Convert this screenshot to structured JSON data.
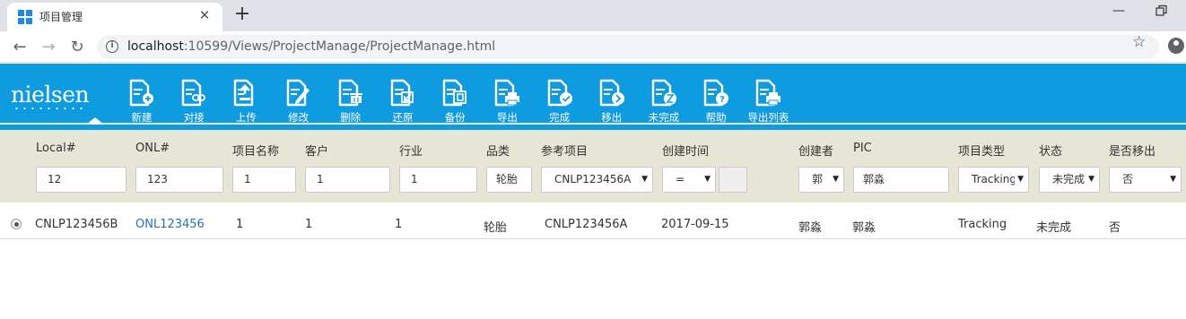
{
  "browser": {
    "tab_title": "项目管理",
    "tab_close": "✕",
    "new_tab": "+",
    "minimize": "—",
    "url_host": "localhost",
    "url_rest": ":10599/Views/ProjectManage/ProjectManage.html",
    "back": "←",
    "forward": "→",
    "reload": "↻",
    "star": "☆"
  },
  "app": {
    "logo": "nielsen",
    "accent_color": "#0f9be0",
    "toolbar": [
      {
        "label": "新建",
        "icon": "new-doc-icon"
      },
      {
        "label": "对接",
        "icon": "link-doc-icon"
      },
      {
        "label": "上传",
        "icon": "upload-doc-icon"
      },
      {
        "label": "修改",
        "icon": "edit-doc-icon"
      },
      {
        "label": "删除",
        "icon": "delete-doc-icon"
      },
      {
        "label": "还原",
        "icon": "restore-doc-icon"
      },
      {
        "label": "备份",
        "icon": "backup-doc-icon"
      },
      {
        "label": "导出",
        "icon": "export-doc-icon"
      },
      {
        "label": "完成",
        "icon": "complete-doc-icon"
      },
      {
        "label": "移出",
        "icon": "move-out-doc-icon"
      },
      {
        "label": "未完成",
        "icon": "incomplete-doc-icon"
      },
      {
        "label": "帮助",
        "icon": "help-doc-icon"
      },
      {
        "label": "导出列表",
        "icon": "export-list-doc-icon"
      }
    ]
  },
  "filters": {
    "headers": {
      "local": "Local#",
      "onl": "ONL#",
      "project_name": "项目名称",
      "client": "客户",
      "industry": "行业",
      "category": "品类",
      "ref_project": "参考项目",
      "created_time": "创建时间",
      "creator": "创建者",
      "pic": "PIC",
      "project_type": "项目类型",
      "status": "状态",
      "moved_out": "是否移出"
    },
    "values": {
      "local": "12",
      "onl": "123",
      "project_name": "1",
      "client": "1",
      "industry": "1",
      "category": "轮胎",
      "ref_project": "CNLP123456A",
      "created_op": "=",
      "creator": "郭",
      "pic": "郭淼",
      "project_type": "Tracking",
      "status": "未完成",
      "moved_out": "否"
    },
    "caret": "▼"
  },
  "results": [
    {
      "local": "CNLP123456B",
      "onl": "ONL123456",
      "project_name": "1",
      "client": "1",
      "industry": "1",
      "category": "轮胎",
      "ref_project": "CNLP123456A",
      "created_time": "2017-09-15",
      "creator": "郭淼",
      "pic": "郭淼",
      "project_type": "Tracking",
      "status": "未完成",
      "moved_out": "否"
    }
  ]
}
